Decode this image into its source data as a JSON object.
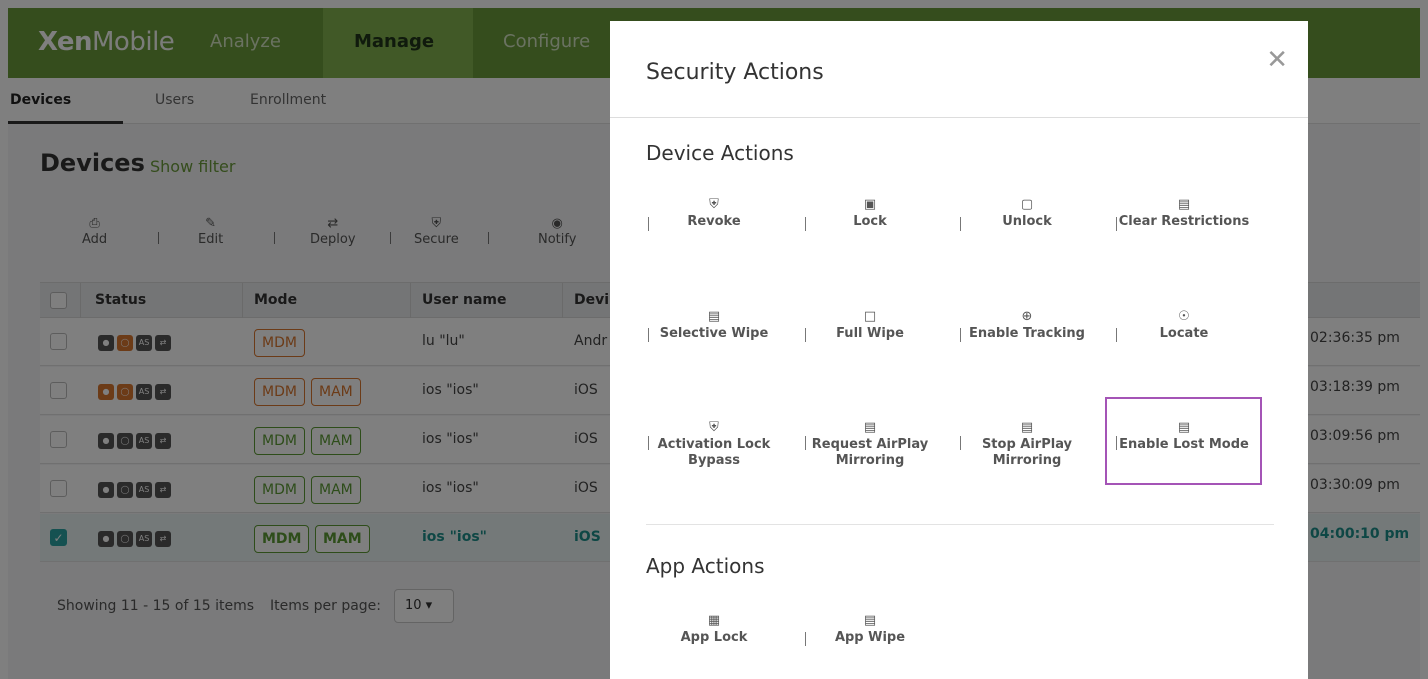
{
  "app": {
    "logo_bold": "Xen",
    "logo_light": "Mobile",
    "nav": [
      "Analyze",
      "Manage",
      "Configure"
    ],
    "subnav": [
      "Devices",
      "Users",
      "Enrollment"
    ]
  },
  "devices_page": {
    "title": "Devices",
    "show_filter": "Show filter",
    "toolbar": [
      {
        "label": "Add",
        "icon": "add-icon"
      },
      {
        "label": "Edit",
        "icon": "edit-icon"
      },
      {
        "label": "Deploy",
        "icon": "deploy-icon"
      },
      {
        "label": "Secure",
        "icon": "secure-icon"
      },
      {
        "label": "Notify",
        "icon": "notify-icon"
      }
    ],
    "columns": [
      "Status",
      "Mode",
      "User name",
      "Devi"
    ],
    "rows": [
      {
        "modes": [
          "MDM"
        ],
        "user": "lu \"lu\"",
        "device": "Andr",
        "time": "02:36:35 pm",
        "selected": false
      },
      {
        "modes": [
          "MDM",
          "MAM"
        ],
        "user": "ios \"ios\"",
        "device": "iOS",
        "time": "03:18:39 pm",
        "selected": false
      },
      {
        "modes": [
          "MDM",
          "MAM"
        ],
        "user": "ios \"ios\"",
        "device": "iOS",
        "time": "03:09:56 pm",
        "selected": false
      },
      {
        "modes": [
          "MDM",
          "MAM"
        ],
        "user": "ios \"ios\"",
        "device": "iOS",
        "time": "03:30:09 pm",
        "selected": false
      },
      {
        "modes": [
          "MDM",
          "MAM"
        ],
        "user": "ios \"ios\"",
        "device": "iOS",
        "time": "04:00:10 pm",
        "selected": true
      }
    ],
    "status_badge_as": "AS",
    "showing": "Showing 11 - 15 of 15 items",
    "items_per_page_label": "Items per page:",
    "items_per_page_value": "10 ▾"
  },
  "modal": {
    "title": "Security Actions",
    "close": "✕",
    "device_actions_title": "Device Actions",
    "device_actions": [
      {
        "label": "Revoke",
        "icon": "shield-icon",
        "glyph": "⛨"
      },
      {
        "label": "Lock",
        "icon": "lock-icon",
        "glyph": "▣"
      },
      {
        "label": "Unlock",
        "icon": "unlock-icon",
        "glyph": "▢"
      },
      {
        "label": "Clear Restrictions",
        "icon": "device-plus-icon",
        "glyph": "▤"
      },
      {
        "label": "Selective Wipe",
        "icon": "device-plus-icon",
        "glyph": "▤"
      },
      {
        "label": "Full Wipe",
        "icon": "device-outline-icon",
        "glyph": "□"
      },
      {
        "label": "Enable Tracking",
        "icon": "crosshair-icon",
        "glyph": "⊕"
      },
      {
        "label": "Locate",
        "icon": "map-pin-icon",
        "glyph": "☉"
      },
      {
        "label": "Activation Lock Bypass",
        "label_line1": "Activation Lock",
        "label_line2": "Bypass",
        "icon": "shield-icon",
        "glyph": "⛨"
      },
      {
        "label": "Request AirPlay Mirroring",
        "label_line1": "Request AirPlay",
        "label_line2": "Mirroring",
        "icon": "device-plus-icon",
        "glyph": "▤"
      },
      {
        "label": "Stop AirPlay Mirroring",
        "label_line1": "Stop AirPlay",
        "label_line2": "Mirroring",
        "icon": "device-plus-icon",
        "glyph": "▤"
      },
      {
        "label": "Enable Lost Mode",
        "icon": "device-plus-icon",
        "glyph": "▤"
      }
    ],
    "app_actions_title": "App Actions",
    "app_actions": [
      {
        "label": "App Lock",
        "icon": "app-lock-icon",
        "glyph": "▦"
      },
      {
        "label": "App Wipe",
        "icon": "app-wipe-icon",
        "glyph": "▤"
      }
    ]
  },
  "colors": {
    "brand_green": "#6a9a3b",
    "teal": "#1d8f8a",
    "orange": "#d9762e",
    "highlight": "#a454b6"
  }
}
